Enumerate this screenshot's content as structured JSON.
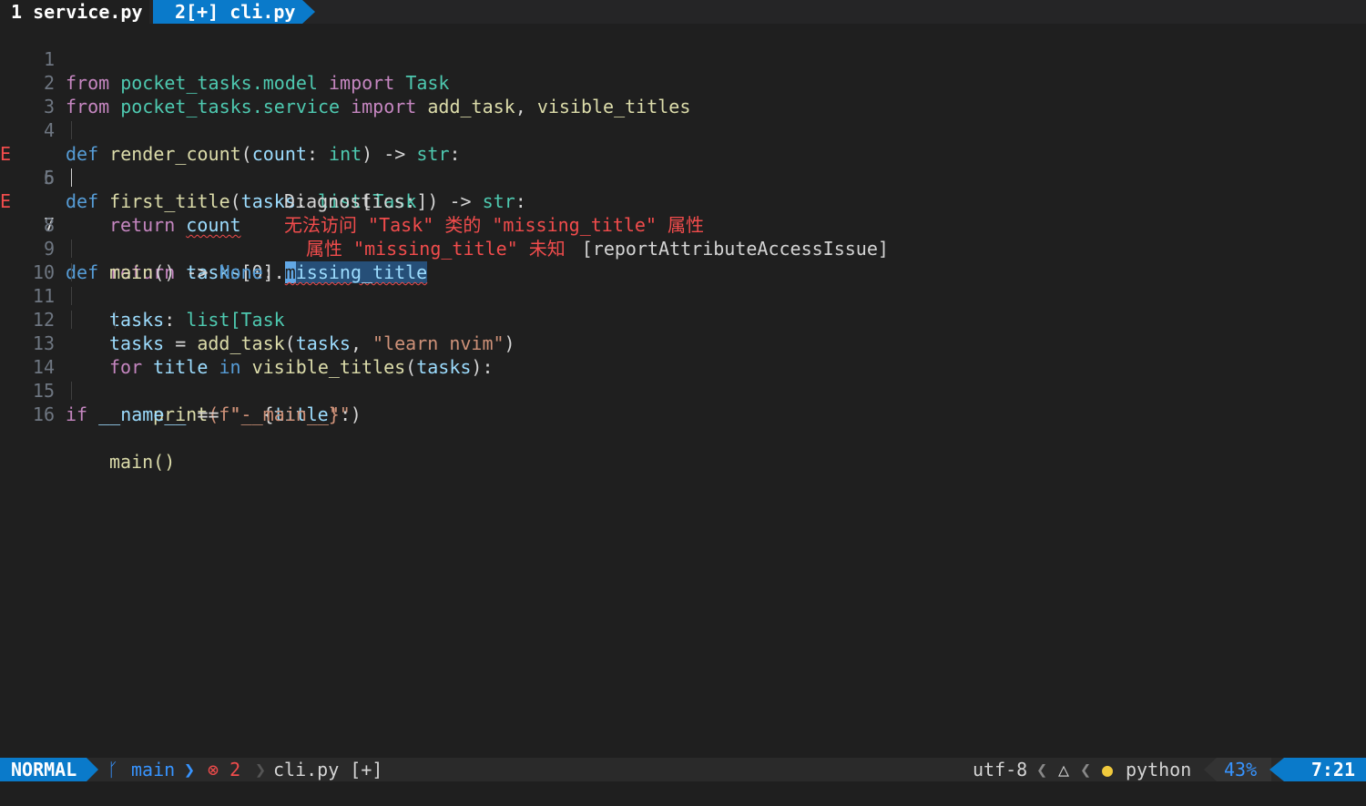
{
  "tabline": {
    "tab1": "1 service.py",
    "tab2": "2[+] cli.py"
  },
  "editor": {
    "lines": [
      {
        "n": "1"
      },
      {
        "n": "2"
      },
      {
        "n": "3"
      },
      {
        "n": "4"
      },
      {
        "n": "5"
      },
      {
        "n": "6"
      },
      {
        "n": "7"
      },
      {
        "n": "8"
      },
      {
        "n": "9"
      },
      {
        "n": "10"
      },
      {
        "n": "11"
      },
      {
        "n": "12"
      },
      {
        "n": "13"
      },
      {
        "n": "14"
      },
      {
        "n": "15"
      },
      {
        "n": "16"
      }
    ],
    "signs": {
      "l5": "E",
      "l7": "E"
    },
    "tokens": {
      "from": "from",
      "import": "import",
      "def": "def",
      "return": "return",
      "for": "for",
      "in": "in",
      "if": "if",
      "mod1": "pocket_tasks",
      "mod1b": ".model",
      "Task": "Task",
      "mod2b": ".service",
      "add_task": "add_task",
      "comma": ", ",
      "visible_titles": "visible_titles",
      "render_count": "render_count",
      "paren_open": "(",
      "count": "count",
      "colon": ": ",
      "int": "int",
      "close_arrow": ") -> ",
      "str": "str",
      "colon_end": ":",
      "first_title": "first_title",
      "tasks": "tasks",
      "list": "list",
      "lb": "[",
      "rb": "]",
      "tasks0": "[0].",
      "m_cursor": "m",
      "missing_rest": "issing_title",
      "main": "main",
      "empty_parens": "() -> ",
      "None": "None",
      "list_task_tail": "list[Task",
      "eq": " = ",
      "learn": "\"learn nvim\"",
      "paren_close": ")",
      "title": "title",
      "print": "print",
      "fstr_open": "(f\"- ",
      "brace_open": "{",
      "brace_close": "}\"",
      "close_paren": ")",
      "name": "__name__",
      "eqeq": " == ",
      "main_str": "\"__main__\"",
      "main_call": "main()"
    }
  },
  "diagnostics": {
    "header": "Diagnostics:",
    "msg1": "无法访问 \"Task\" 类的 \"missing_title\" 属性",
    "msg2": "属性 \"missing_title\" 未知",
    "code": "[reportAttributeAccessIssue]"
  },
  "statusline": {
    "mode": "NORMAL",
    "branch": "main",
    "errors": "⊗ 2",
    "file": "cli.py [+]",
    "encoding": "utf-8",
    "filetype": "python",
    "percent": "43%",
    "position": "7:21"
  },
  "colors": {
    "accent": "#0a7aca",
    "error": "#f14c4c",
    "background": "#1f1f1f"
  }
}
